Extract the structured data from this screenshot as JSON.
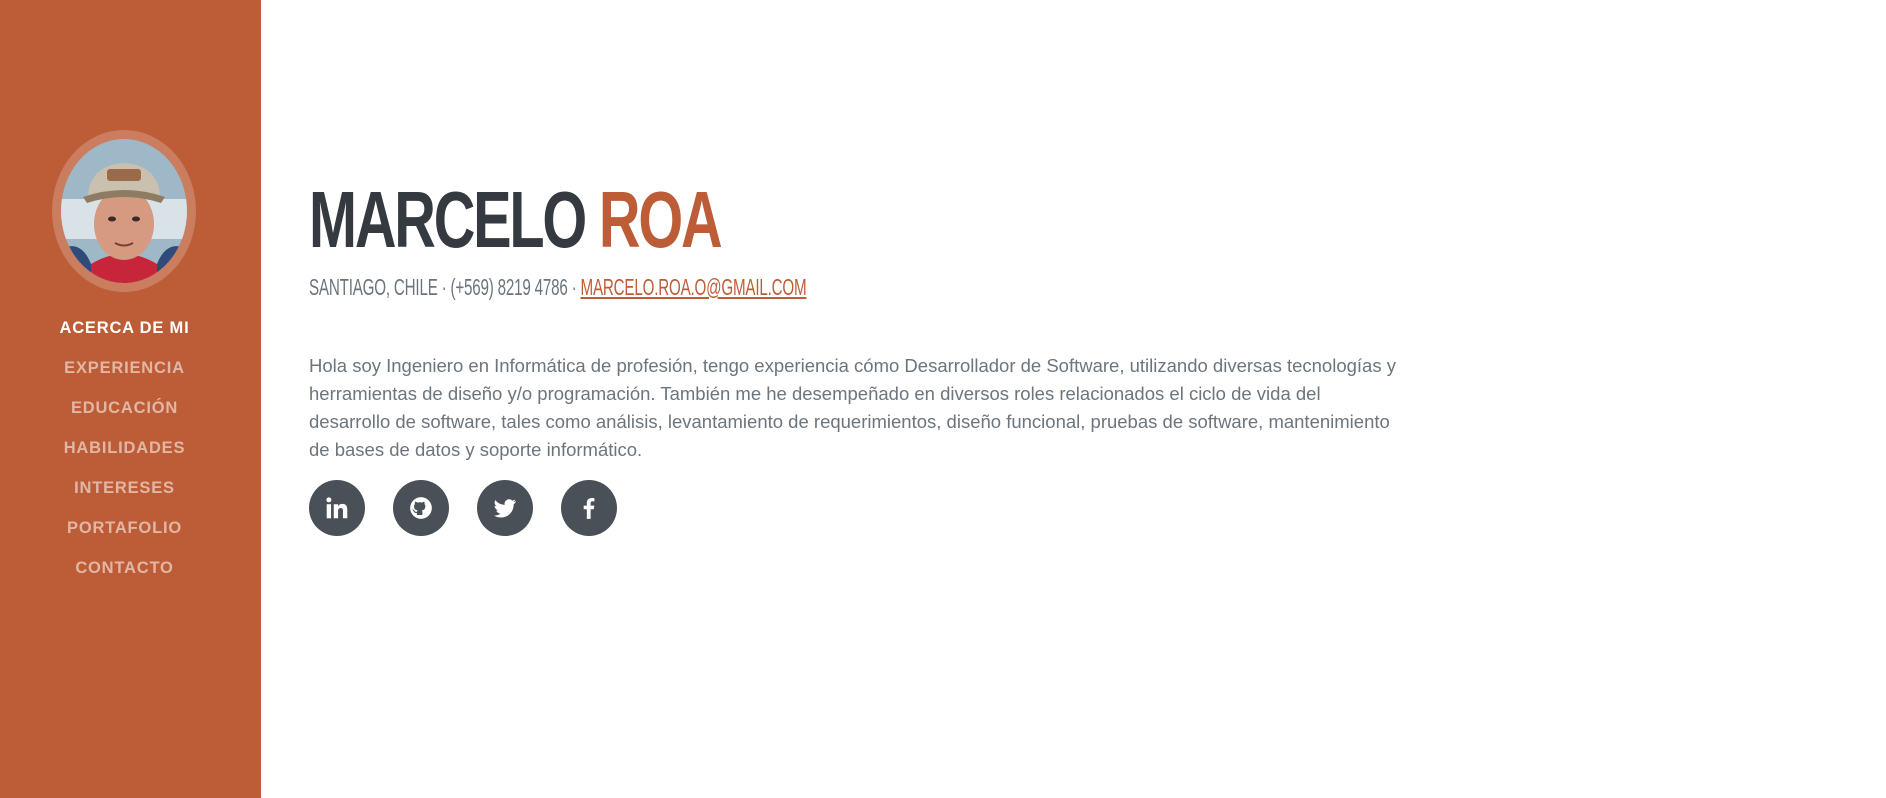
{
  "sidebar": {
    "avatar_alt": "Marcelo Roa",
    "nav": [
      {
        "label": "ACERCA DE MI",
        "active": true
      },
      {
        "label": "EXPERIENCIA",
        "active": false
      },
      {
        "label": "EDUCACIÓN",
        "active": false
      },
      {
        "label": "HABILIDADES",
        "active": false
      },
      {
        "label": "INTERESES",
        "active": false
      },
      {
        "label": "PORTAFOLIO",
        "active": false
      },
      {
        "label": "CONTACTO",
        "active": false
      }
    ]
  },
  "about": {
    "first_name": "MARCELO",
    "last_name": "ROA",
    "location_phone": "SANTIAGO, CHILE · (+569) 8219 4786 ·",
    "email": "MARCELO.ROA.O@GMAIL.COM",
    "bio": "Hola soy Ingeniero en Informática de profesión, tengo experiencia cómo Desarrollador de Software, utilizando diversas tecnologías y herramientas de diseño y/o programación. También me he desempeñado en diversos roles relacionados el ciclo de vida del desarrollo de software, tales como análisis, levantamiento de requerimientos, diseño funcional, pruebas de software, mantenimiento de bases de datos y soporte informático."
  },
  "social": [
    {
      "icon": "linkedin-icon"
    },
    {
      "icon": "github-icon"
    },
    {
      "icon": "twitter-icon"
    },
    {
      "icon": "facebook-icon"
    }
  ],
  "colors": {
    "primary": "#bd5d38",
    "dark": "#343a40",
    "muted": "#6c757d",
    "social_bg": "#495057"
  }
}
